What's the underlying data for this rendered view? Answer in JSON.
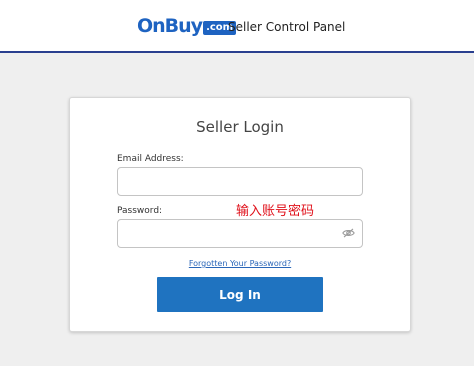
{
  "header": {
    "logo_text": "OnBuy",
    "logo_suffix": ".com",
    "title": "Seller Control Panel"
  },
  "login": {
    "title": "Seller Login",
    "email_label": "Email Address:",
    "email_value": "",
    "password_label": "Password:",
    "password_value": "",
    "annotation": "输入账号密码",
    "forgot_link": "Forgotten Your Password?",
    "submit_label": "Log In"
  },
  "icons": {
    "password_toggle": "eye-slash-icon"
  },
  "colors": {
    "brand_blue": "#1e63c1",
    "button_blue": "#1f73c0",
    "header_border": "#2a3f8f",
    "page_background": "#efefef",
    "annotation_red": "#e0101a",
    "link_blue": "#2a66b8"
  }
}
